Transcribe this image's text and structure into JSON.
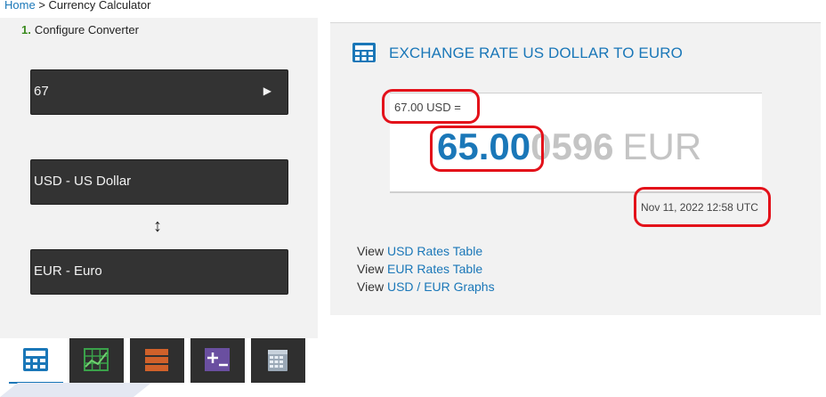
{
  "breadcrumb": {
    "home": "Home",
    "separator": ">",
    "current": "Currency Calculator"
  },
  "config": {
    "step_number": "1.",
    "step_label": "Configure Converter",
    "amount_value": "67",
    "from_currency": "USD - US Dollar",
    "swap_symbol": "↕",
    "to_currency": "EUR - Euro"
  },
  "tabs": [
    {
      "name": "converter-tab",
      "icon": "calculator-icon",
      "active": true
    },
    {
      "name": "chart-tab",
      "icon": "chart-grid-icon",
      "active": false
    },
    {
      "name": "table-tab",
      "icon": "table-rows-icon",
      "active": false
    },
    {
      "name": "plus-minus-tab",
      "icon": "plus-minus-icon",
      "active": false
    },
    {
      "name": "calendar-tab",
      "icon": "calendar-icon",
      "active": false
    }
  ],
  "result": {
    "title": "EXCHANGE RATE US DOLLAR TO EURO",
    "from_amount": "67.00 USD =",
    "value_main": "65.00",
    "value_rest": "0596",
    "to_currency": "EUR",
    "timestamp": "Nov 11, 2022 12:58 UTC"
  },
  "links": [
    {
      "prefix": "View",
      "label": "USD Rates Table"
    },
    {
      "prefix": "View",
      "label": "EUR Rates Table"
    },
    {
      "prefix": "View",
      "label": "USD / EUR Graphs"
    }
  ],
  "colors": {
    "accent": "#1a77b8",
    "highlight": "#e3111a",
    "field_bg": "#333333"
  }
}
